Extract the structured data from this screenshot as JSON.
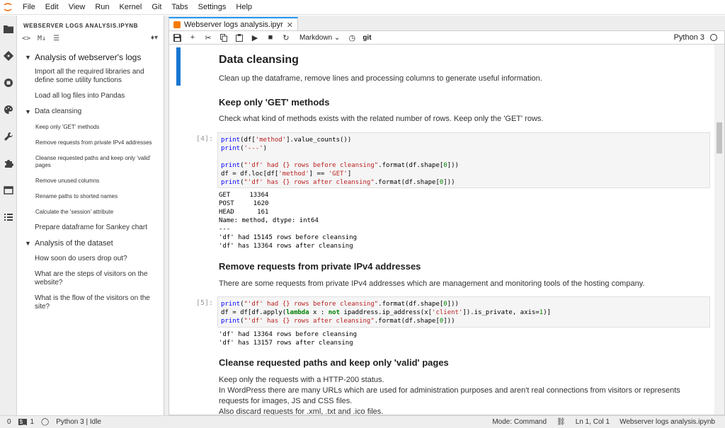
{
  "menubar": {
    "items": [
      "File",
      "Edit",
      "View",
      "Run",
      "Kernel",
      "Git",
      "Tabs",
      "Settings",
      "Help"
    ]
  },
  "toc": {
    "title": "WEBSERVER LOGS ANALYSIS.IPYNB",
    "tools": [
      "<>",
      "M↓",
      "☰"
    ],
    "h1_a": "Analysis of webserver's logs",
    "h2_import": "Import all the required libraries and define some utility functions",
    "h2_load": "Load all log files into Pandas",
    "h2_cleansing": "Data cleansing",
    "h3_get": "Keep only 'GET' methods",
    "h3_private": "Remove requests from private IPv4 addresses",
    "h3_cleanse": "Cleanse requested paths and keep only 'valid' pages",
    "h3_unused": "Remove unused columns",
    "h3_rename": "Rename paths to shorted names",
    "h3_session": "Calculate the 'session' attribute",
    "h2_sankey": "Prepare dataframe for Sankey chart",
    "h1_b": "Analysis of the dataset",
    "h2_dropout": "How soon do users drop out?",
    "h2_steps": "What are the steps of visitors on the website?",
    "h2_flow": "What is the flow of the visitors on the site?"
  },
  "tab": {
    "label": "Webserver logs analysis.ipyr",
    "close": "✕"
  },
  "toolbar": {
    "celltype": "Markdown",
    "git": "git",
    "kernel": "Python 3"
  },
  "notebook": {
    "h2_cleansing": "Data cleansing",
    "p_cleansing": "Clean up the dataframe, remove lines and processing columns to generate useful information.",
    "h3_get": "Keep only 'GET' methods",
    "p_get": "Check what kind of methods exists with the related number of rows. Keep only the 'GET' rows.",
    "prompt4": "[4]:",
    "out4": "GET     13364\nPOST     1620\nHEAD      161\nName: method, dtype: int64\n---\n'df' had 15145 rows before cleansing\n'df' has 13364 rows after cleansing",
    "h3_private": "Remove requests from private IPv4 addresses",
    "p_private": "There are some requests from private IPv4 addresses which are management and monitoring tools of the hosting company.",
    "prompt5": "[5]:",
    "out5": "'df' had 13364 rows before cleansing\n'df' has 13157 rows after cleansing",
    "h3_cleanse": "Cleanse requested paths and keep only 'valid' pages",
    "p_cleanse_1": "Keep only the requests with a HTTP-200 status.",
    "p_cleanse_2": "In WordPress there are many URLs which are used for administration purposes and aren't real connections from visitors or represents requests for images, JS and CSS files.",
    "p_cleanse_3": "Also discard requests for .xml, .txt and .ico files."
  },
  "statusbar": {
    "zero": "0",
    "terminal_icon": "$_",
    "one": "1",
    "kernel": "Python 3 | Idle",
    "mode": "Mode: Command",
    "position": "Ln 1, Col 1",
    "filename": "Webserver logs analysis.ipynb"
  },
  "colors": {
    "accent": "#2196f3",
    "cell_marker": "#1976d2",
    "notebook_icon": "#f57c00"
  }
}
